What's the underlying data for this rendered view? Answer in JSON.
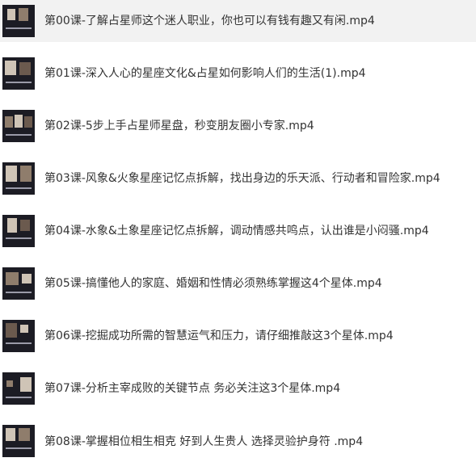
{
  "files": [
    {
      "name": "第00课-了解占星师这个迷人职业，你也可以有钱有趣又有闲.mp4",
      "selected": true,
      "thumbnail_icon": "video-thumbnail-icon"
    },
    {
      "name": "第01课-深入人心的星座文化&占星如何影响人们的生活(1).mp4",
      "selected": false,
      "thumbnail_icon": "video-thumbnail-icon"
    },
    {
      "name": "第02课-5步上手占星师星盘，秒变朋友圈小专家.mp4",
      "selected": false,
      "thumbnail_icon": "video-thumbnail-icon"
    },
    {
      "name": "第03课-风象&火象星座记忆点拆解，找出身边的乐天派、行动者和冒险家.mp4",
      "selected": false,
      "thumbnail_icon": "video-thumbnail-icon"
    },
    {
      "name": "第04课-水象&土象星座记忆点拆解，调动情感共鸣点，认出谁是小闷骚.mp4",
      "selected": false,
      "thumbnail_icon": "video-thumbnail-icon"
    },
    {
      "name": "第05课-搞懂他人的家庭、婚姻和性情必须熟练掌握这4个星体.mp4",
      "selected": false,
      "thumbnail_icon": "video-thumbnail-icon"
    },
    {
      "name": "第06课-挖掘成功所需的智慧运气和压力，请仔细推敲这3个星体.mp4",
      "selected": false,
      "thumbnail_icon": "video-thumbnail-icon"
    },
    {
      "name": "第07课-分析主宰成败的关键节点 务必关注这3个星体.mp4",
      "selected": false,
      "thumbnail_icon": "video-thumbnail-icon"
    },
    {
      "name": "第08课-掌握相位相生相克 好到人生贵人 选择灵验护身符 .mp4",
      "selected": false,
      "thumbnail_icon": "video-thumbnail-icon"
    }
  ],
  "colors": {
    "text": "#333333",
    "selected_background": "#f2f2f2",
    "thumbnail_background": "#1c1c24"
  }
}
